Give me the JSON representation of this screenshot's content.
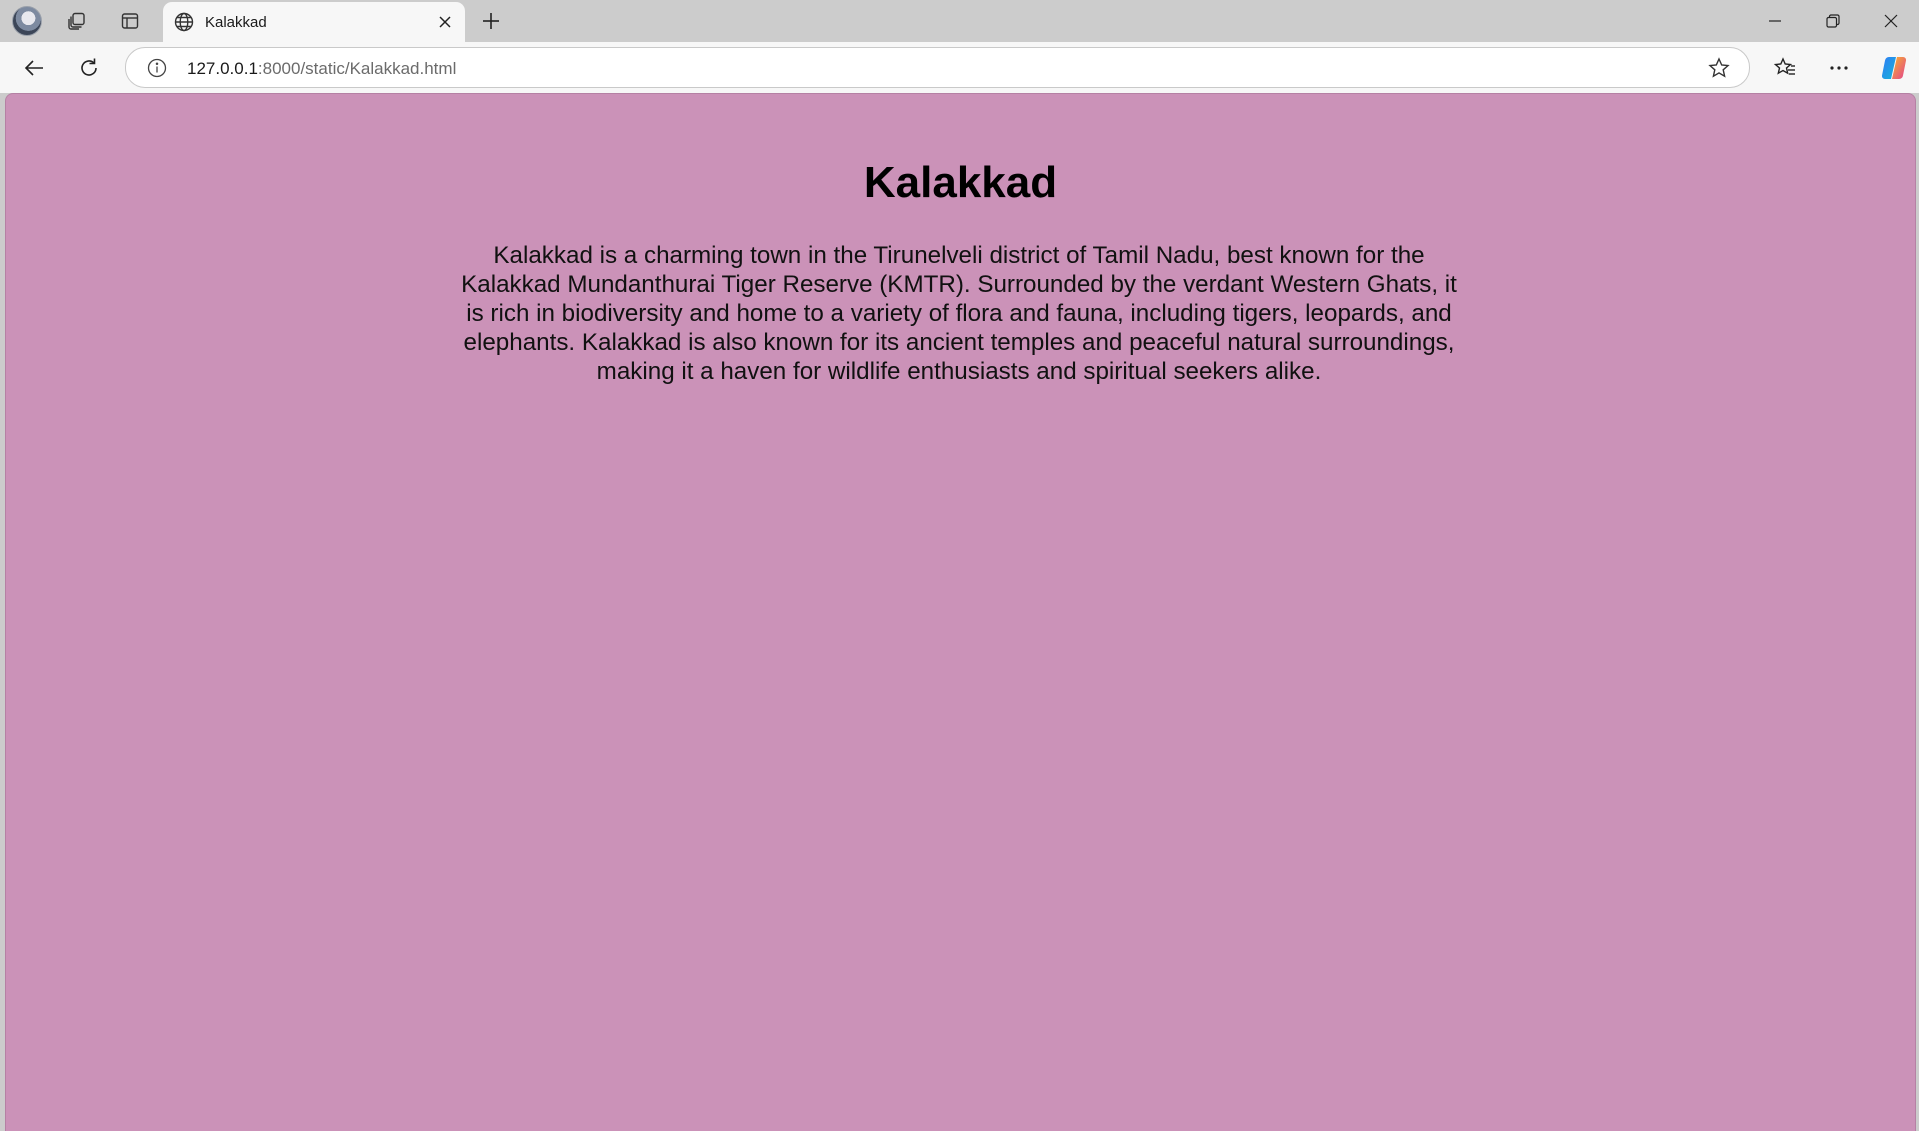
{
  "browser": {
    "tab": {
      "title": "Kalakkad",
      "icon": "globe-icon"
    },
    "address": {
      "host": "127.0.0.1",
      "rest": ":8000/static/Kalakkad.html"
    },
    "toolbar_icons": [
      "back-icon",
      "reload-icon",
      "site-info-icon",
      "star-icon",
      "favorites-icon",
      "more-icon",
      "copilot-icon"
    ],
    "window_controls": [
      "minimize-icon",
      "restore-icon",
      "close-icon"
    ]
  },
  "page": {
    "background": "#cb92b8",
    "title": "Kalakkad",
    "paragraph": "Kalakkad is a charming town in the Tirunelveli district of Tamil Nadu, best known for the Kalakkad Mundanthurai Tiger Reserve (KMTR). Surrounded by the verdant Western Ghats, it is rich in biodiversity and home to a variety of flora and fauna, including tigers, leopards, and elephants. Kalakkad is also known for its ancient temples and peaceful natural surroundings, making it a haven for wildlife enthusiasts and spiritual seekers alike."
  }
}
